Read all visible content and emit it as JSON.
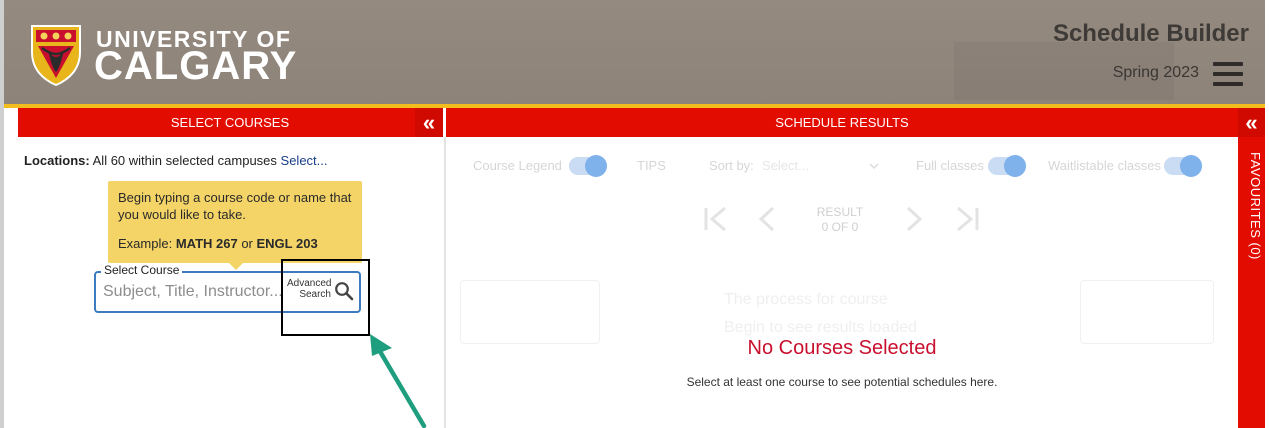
{
  "header": {
    "university_line1": "UNIVERSITY OF",
    "university_line2": "CALGARY",
    "app_title": "Schedule Builder",
    "term": "Spring 2023"
  },
  "left_panel": {
    "bar_title": "SELECT COURSES",
    "collapse_glyph": "«",
    "locations_label": "Locations:",
    "locations_value": "All 60 within selected campuses",
    "locations_link": "Select...",
    "tooltip": {
      "line1": "Begin typing a course code or name that you would like to take.",
      "example_prefix": "Example: ",
      "example_code1": "MATH 267",
      "example_or": " or ",
      "example_code2": "ENGL 203"
    },
    "course_field": {
      "legend": "Select Course",
      "placeholder": "Subject, Title, Instructor...",
      "advanced_line1": "Advanced",
      "advanced_line2": "Search"
    }
  },
  "results_panel": {
    "bar_title": "SCHEDULE RESULTS",
    "collapse_glyph": "«",
    "course_legend": "Course Legend",
    "tips": "TIPS",
    "sort_by_label": "Sort by:",
    "sort_by_value": "Select...",
    "full_classes": "Full classes",
    "waitlistable_classes": "Waitlistable classes",
    "result_label": "RESULT",
    "result_count": "0 OF 0",
    "ghost_line1": "The process for course",
    "ghost_line2": "Begin to see results loaded",
    "empty_title": "No Courses Selected",
    "empty_subtitle": "Select at least one course to see potential schedules here."
  },
  "favourites": {
    "label": "FAVOURITES (0)"
  },
  "colors": {
    "header_bg": "#8d8379",
    "accent_red": "#e30c00",
    "gold": "#f2bd1d",
    "tooltip_bg": "#f4d467",
    "input_border": "#3c7bbf",
    "empty_title": "#c8102e",
    "annotation_arrow": "#1e9e7e"
  },
  "icons": {
    "logo": "university-crest-icon",
    "menu": "hamburger-menu-icon",
    "search": "search-icon",
    "collapse": "double-chevron-left-icon",
    "first_page": "first-page-icon",
    "previous": "chevron-left-icon",
    "next": "chevron-right-icon",
    "last_page": "last-page-icon",
    "annotation": "annotation-arrow-icon"
  }
}
